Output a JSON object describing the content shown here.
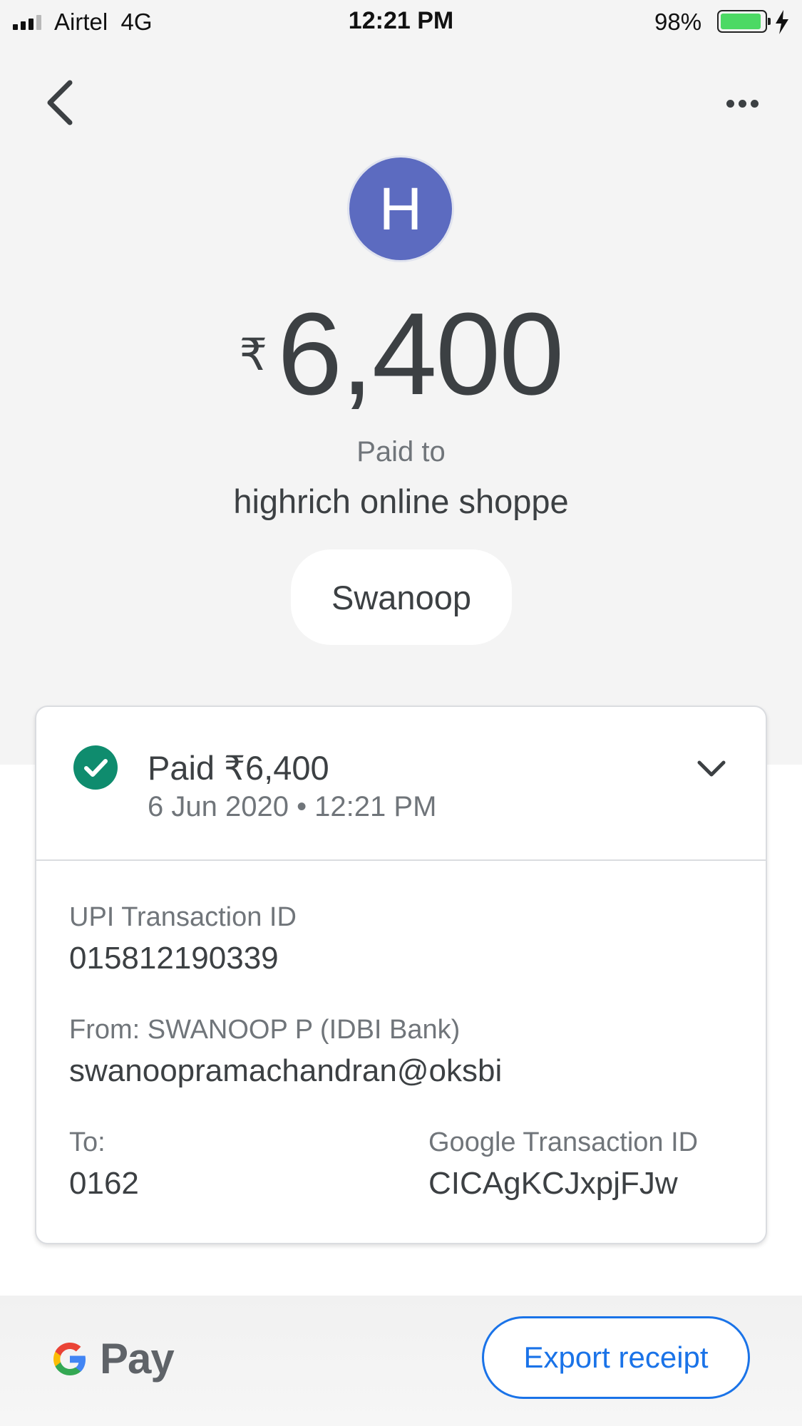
{
  "status_bar": {
    "carrier": "Airtel  4G",
    "time": "12:21 PM",
    "battery": "98%",
    "battery_level": 0.98
  },
  "nav": {
    "back_icon": "chevron-left-icon",
    "more_icon": "more-horizontal-icon"
  },
  "avatar": {
    "initial": "H",
    "color": "#5c6bc0"
  },
  "payment": {
    "currency_symbol": "₹",
    "amount": "6,400",
    "paid_to_label": "Paid to",
    "payee": "highrich online shoppe",
    "chip_label": "Swanoop"
  },
  "card": {
    "status": "Paid ₹6,400",
    "date": "6 Jun 2020 • 12:21 PM",
    "status_color": "#0f8c6e",
    "upi_label": "UPI Transaction ID",
    "upi_value": "015812190339",
    "from_label": "From: SWANOOP P (IDBI Bank)",
    "from_value": "swanoopramachandran@oksbi",
    "to_label": "To:",
    "to_value": "0162",
    "google_label": "Google Transaction ID",
    "google_value": "CICAgKCJxpjFJw"
  },
  "footer": {
    "brand_pay": "Pay",
    "export_label": "Export receipt",
    "accent": "#1a73e8"
  }
}
